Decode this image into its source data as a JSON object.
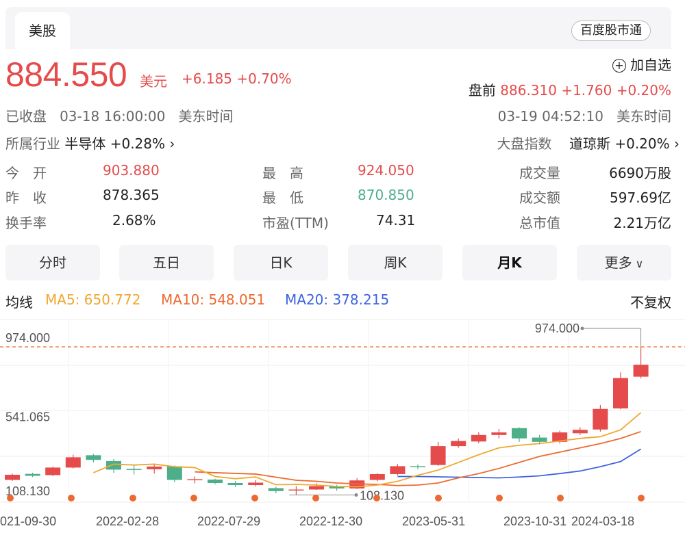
{
  "tabs": {
    "active": "美股",
    "brand": "百度股市通"
  },
  "quote": {
    "price": "884.550",
    "unit": "美元",
    "change": "+6.185 +0.70%",
    "add_watch": "加自选",
    "premarket_label": "盘前",
    "premarket_value": "886.310 +1.760 +0.20%",
    "status": "已收盘",
    "close_time": "03-18 16:00:00",
    "tz": "美东时间",
    "pre_time": "03-19 04:52:10",
    "industry_label": "所属行业",
    "industry_name": "半导体",
    "industry_change": "+0.28%",
    "index_label": "大盘指数",
    "index_name": "道琼斯",
    "index_change": "+0.20%"
  },
  "stats": {
    "open_label": "今　开",
    "open": "903.880",
    "prev_label": "昨　收",
    "prev": "878.365",
    "turnover_label": "换手率",
    "turnover": "2.68%",
    "high_label": "最　高",
    "high": "924.050",
    "low_label": "最　低",
    "low": "870.850",
    "pe_label": "市盈(TTM)",
    "pe": "74.31",
    "vol_label": "成交量",
    "vol": "6690万股",
    "amount_label": "成交额",
    "amount": "597.69亿",
    "mcap_label": "总市值",
    "mcap": "2.21万亿"
  },
  "periods": [
    "分时",
    "五日",
    "日K",
    "周K",
    "月K",
    "更多"
  ],
  "active_period": "月K",
  "ma": {
    "label": "均线",
    "ma5": "MA5: 650.772",
    "ma10": "MA10: 548.051",
    "ma20": "MA20: 378.215",
    "adjust": "不复权"
  },
  "colors": {
    "up": "#e54b4b",
    "down": "#4caf8a",
    "ma5": "#f0a82f",
    "ma10": "#ec6a2f",
    "ma20": "#3f63e0"
  },
  "chart_data": {
    "type": "candlestick",
    "y_labels": [
      "974.000",
      "541.065",
      "108.130"
    ],
    "max_marker": "974.000",
    "min_marker": "108.130",
    "x_labels": [
      "2021-09-30",
      "2022-02-28",
      "2022-07-29",
      "2022-12-30",
      "2023-05-31",
      "2023-10-31",
      "2024-03-18"
    ],
    "ylim": [
      108.13,
      974.0
    ],
    "candles": [
      {
        "o": 198,
        "c": 228,
        "h": 235,
        "l": 192
      },
      {
        "o": 233,
        "c": 222,
        "h": 240,
        "l": 215
      },
      {
        "o": 226,
        "c": 270,
        "h": 275,
        "l": 220
      },
      {
        "o": 270,
        "c": 330,
        "h": 345,
        "l": 265
      },
      {
        "o": 342,
        "c": 315,
        "h": 350,
        "l": 300
      },
      {
        "o": 308,
        "c": 258,
        "h": 320,
        "l": 240
      },
      {
        "o": 262,
        "c": 258,
        "h": 285,
        "l": 230
      },
      {
        "o": 260,
        "c": 276,
        "h": 290,
        "l": 235
      },
      {
        "o": 278,
        "c": 198,
        "h": 282,
        "l": 185
      },
      {
        "o": 197,
        "c": 202,
        "h": 218,
        "l": 178
      },
      {
        "o": 200,
        "c": 180,
        "h": 205,
        "l": 172
      },
      {
        "o": 180,
        "c": 168,
        "h": 192,
        "l": 158
      },
      {
        "o": 168,
        "c": 182,
        "h": 198,
        "l": 160
      },
      {
        "o": 150,
        "c": 133,
        "h": 158,
        "l": 120
      },
      {
        "o": 140,
        "c": 142,
        "h": 162,
        "l": 110
      },
      {
        "o": 142,
        "c": 162,
        "h": 178,
        "l": 140
      },
      {
        "o": 160,
        "c": 148,
        "h": 170,
        "l": 135
      },
      {
        "o": 148,
        "c": 195,
        "h": 208,
        "l": 145
      },
      {
        "o": 198,
        "c": 232,
        "h": 238,
        "l": 190
      },
      {
        "o": 232,
        "c": 278,
        "h": 290,
        "l": 225
      },
      {
        "o": 278,
        "c": 272,
        "h": 288,
        "l": 260
      },
      {
        "o": 285,
        "c": 395,
        "h": 420,
        "l": 280
      },
      {
        "o": 395,
        "c": 425,
        "h": 440,
        "l": 385
      },
      {
        "o": 422,
        "c": 460,
        "h": 475,
        "l": 412
      },
      {
        "o": 460,
        "c": 475,
        "h": 495,
        "l": 440
      },
      {
        "o": 500,
        "c": 440,
        "h": 505,
        "l": 420
      },
      {
        "o": 445,
        "c": 420,
        "h": 460,
        "l": 405
      },
      {
        "o": 420,
        "c": 475,
        "h": 485,
        "l": 410
      },
      {
        "o": 470,
        "c": 490,
        "h": 505,
        "l": 460
      },
      {
        "o": 492,
        "c": 612,
        "h": 635,
        "l": 480
      },
      {
        "o": 615,
        "c": 792,
        "h": 825,
        "l": 610
      },
      {
        "o": 800,
        "c": 870,
        "h": 974,
        "l": 790
      }
    ],
    "ma5": [
      null,
      null,
      null,
      null,
      240,
      290,
      285,
      290,
      275,
      270,
      218,
      205,
      215,
      170,
      172,
      168,
      160,
      158,
      168,
      190,
      225,
      255,
      300,
      345,
      385,
      400,
      410,
      425,
      440,
      450,
      490,
      590
    ],
    "ma10": [
      null,
      null,
      null,
      null,
      null,
      null,
      null,
      null,
      null,
      245,
      240,
      236,
      232,
      214,
      196,
      190,
      180,
      175,
      172,
      165,
      168,
      180,
      210,
      235,
      265,
      300,
      335,
      360,
      385,
      410,
      440,
      480
    ],
    "ma20": [
      null,
      null,
      null,
      null,
      null,
      null,
      null,
      null,
      null,
      null,
      null,
      null,
      null,
      null,
      null,
      null,
      null,
      null,
      null,
      218,
      218,
      216,
      214,
      212,
      210,
      215,
      222,
      235,
      250,
      275,
      305,
      378
    ]
  }
}
